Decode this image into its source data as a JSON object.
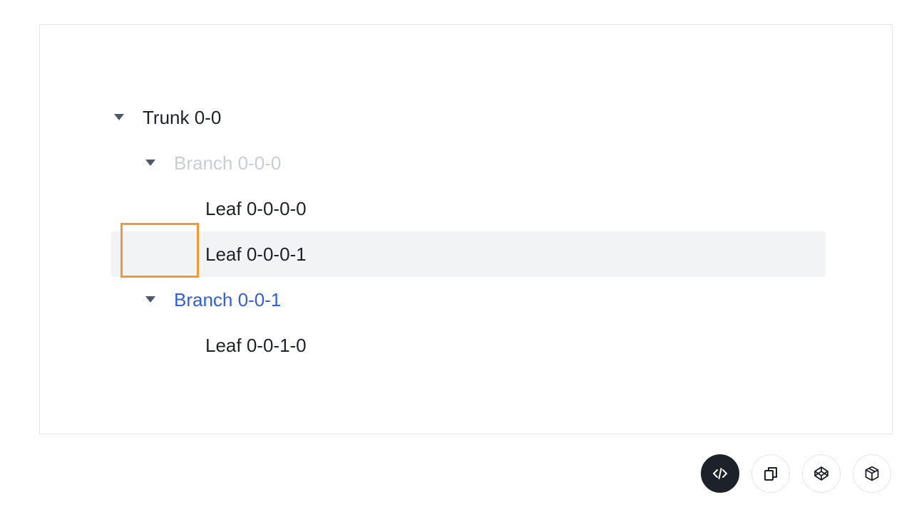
{
  "tree": {
    "trunk": {
      "label": "Trunk 0-0"
    },
    "branch0": {
      "label": "Branch 0-0-0"
    },
    "leaf0": {
      "label": "Leaf 0-0-0-0"
    },
    "leaf1": {
      "label": "Leaf 0-0-0-1"
    },
    "branch1": {
      "label": "Branch 0-0-1"
    },
    "leaf2": {
      "label": "Leaf 0-0-1-0"
    }
  },
  "toolbar": {
    "icons": [
      "code-icon",
      "copy-icon",
      "codepen-icon",
      "codesandbox-icon"
    ]
  },
  "colors": {
    "text": "#1d2129",
    "disabled": "#c9cdd4",
    "link": "#2f5fe0",
    "hover_bg": "#f2f3f5",
    "drag_indicator": "#f09a35"
  }
}
